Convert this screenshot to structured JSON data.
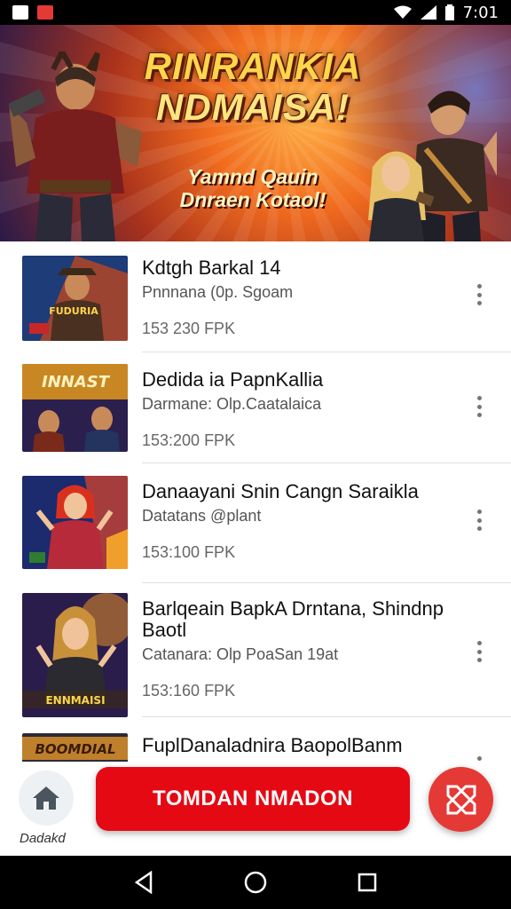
{
  "status_bar": {
    "time": "7:01",
    "left_icons": [
      "gallery-icon",
      "app-notification-icon"
    ],
    "right_icons": [
      "wifi-icon",
      "signal-icon",
      "battery-icon"
    ]
  },
  "banner": {
    "title_line1": "RINRANKIA",
    "title_line2": "NDMAISA!",
    "subtitle_line1": "Yamnd Qauin",
    "subtitle_line2": "Dnraen Kotaol!",
    "page_count": 4,
    "active_page": 2,
    "colors": {
      "title": "#ffd54a",
      "bg_mid": "#f06b1e",
      "bg_dark": "#2a1a4a"
    }
  },
  "list": {
    "items": [
      {
        "title": "Kdtgh Barkal  14",
        "subtitle": "Pnnnana (0p. Sgoam",
        "price": "153  230  FPK",
        "thumb_text": "FUDURIA",
        "thumb_palette": [
          "#1e3c78",
          "#c7471b"
        ]
      },
      {
        "title": "Dedida  ia  PapnKallia",
        "subtitle": "Darmane: Olp.Caatalaica",
        "price": "153:200  FPK",
        "thumb_text": "INNAST",
        "thumb_palette": [
          "#2b1f4e",
          "#e59a1c"
        ]
      },
      {
        "title": "Danaayani Snin Cangn Saraikla",
        "subtitle": "Datatans @plant",
        "price": "153:100  FPK",
        "thumb_text": "",
        "thumb_palette": [
          "#1c2a6e",
          "#e04626"
        ]
      },
      {
        "title": "Barlqeain BapkA Drntana, Shindnp Baotl",
        "subtitle": "Catanara: Olp PoaSan  19at",
        "price": "153:160  FPK",
        "thumb_text": "ENNMAISI",
        "thumb_palette": [
          "#2a1d4c",
          "#d9852a"
        ]
      },
      {
        "title": "FuplDanaladnira BaopolBanm",
        "subtitle": "",
        "price": "",
        "thumb_text": "BOOMDIAL",
        "thumb_palette": [
          "#2a2a3a",
          "#d98f2a"
        ]
      }
    ]
  },
  "bottom": {
    "home_label": "Dadakd",
    "cta_label": "TOMDAN NMADON",
    "fab_icon": "crossed-swords-icon",
    "cta_color": "#e50914"
  },
  "nav": {
    "icons": [
      "back-icon",
      "home-circle-icon",
      "recents-icon"
    ]
  }
}
